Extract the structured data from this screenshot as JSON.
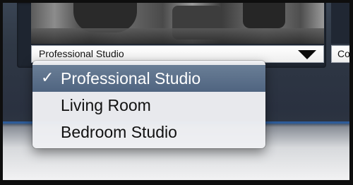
{
  "preset_select": {
    "value": "Professional Studio",
    "side_value": "Co"
  },
  "menu": {
    "check_glyph": "✓",
    "items": [
      {
        "label": "Professional Studio",
        "selected": true
      },
      {
        "label": "Living Room",
        "selected": false
      },
      {
        "label": "Bedroom Studio",
        "selected": false
      }
    ]
  },
  "colors": {
    "selection_highlight": "#5b6f89",
    "accent_line": "#2e5c99"
  }
}
